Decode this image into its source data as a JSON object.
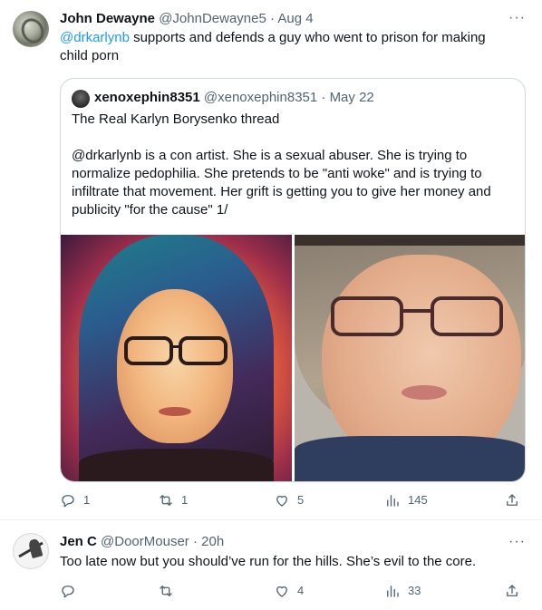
{
  "tweet1": {
    "name": "John Dewayne",
    "handle": "@JohnDewayne5",
    "separator": "·",
    "time": "Aug 4",
    "mention": "@drkarlynb",
    "text": " supports and defends a guy who went to prison for making child porn",
    "quote": {
      "name": "xenoxephin8351",
      "handle": "@xenoxephin8351",
      "separator": "·",
      "time": "May 22",
      "line1": "The Real Karlyn Borysenko thread",
      "line2": "@drkarlynb is a con artist. She is a sexual abuser. She is trying to normalize pedophilia. She pretends to be \"anti woke\" and is trying to infiltrate that movement. Her grift is getting you to give her money and publicity \"for the cause\" 1/"
    },
    "actions": {
      "replies": "1",
      "retweets": "1",
      "likes": "5",
      "views": "145"
    }
  },
  "tweet2": {
    "name": "Jen C",
    "handle": "@DoorMouser",
    "separator": "·",
    "time": "20h",
    "text": "Too late now but you should’ve run for the hills. She’s evil to the core.",
    "actions": {
      "replies": "",
      "retweets": "",
      "likes": "4",
      "views": "33"
    }
  },
  "more_label": "···",
  "icons": [
    "reply-icon",
    "retweet-icon",
    "like-icon",
    "views-icon",
    "share-icon",
    "more-icon"
  ],
  "colors": {
    "accent": "#1d9bf0",
    "secondary_text": "#536471",
    "border": "#cfd9de"
  }
}
